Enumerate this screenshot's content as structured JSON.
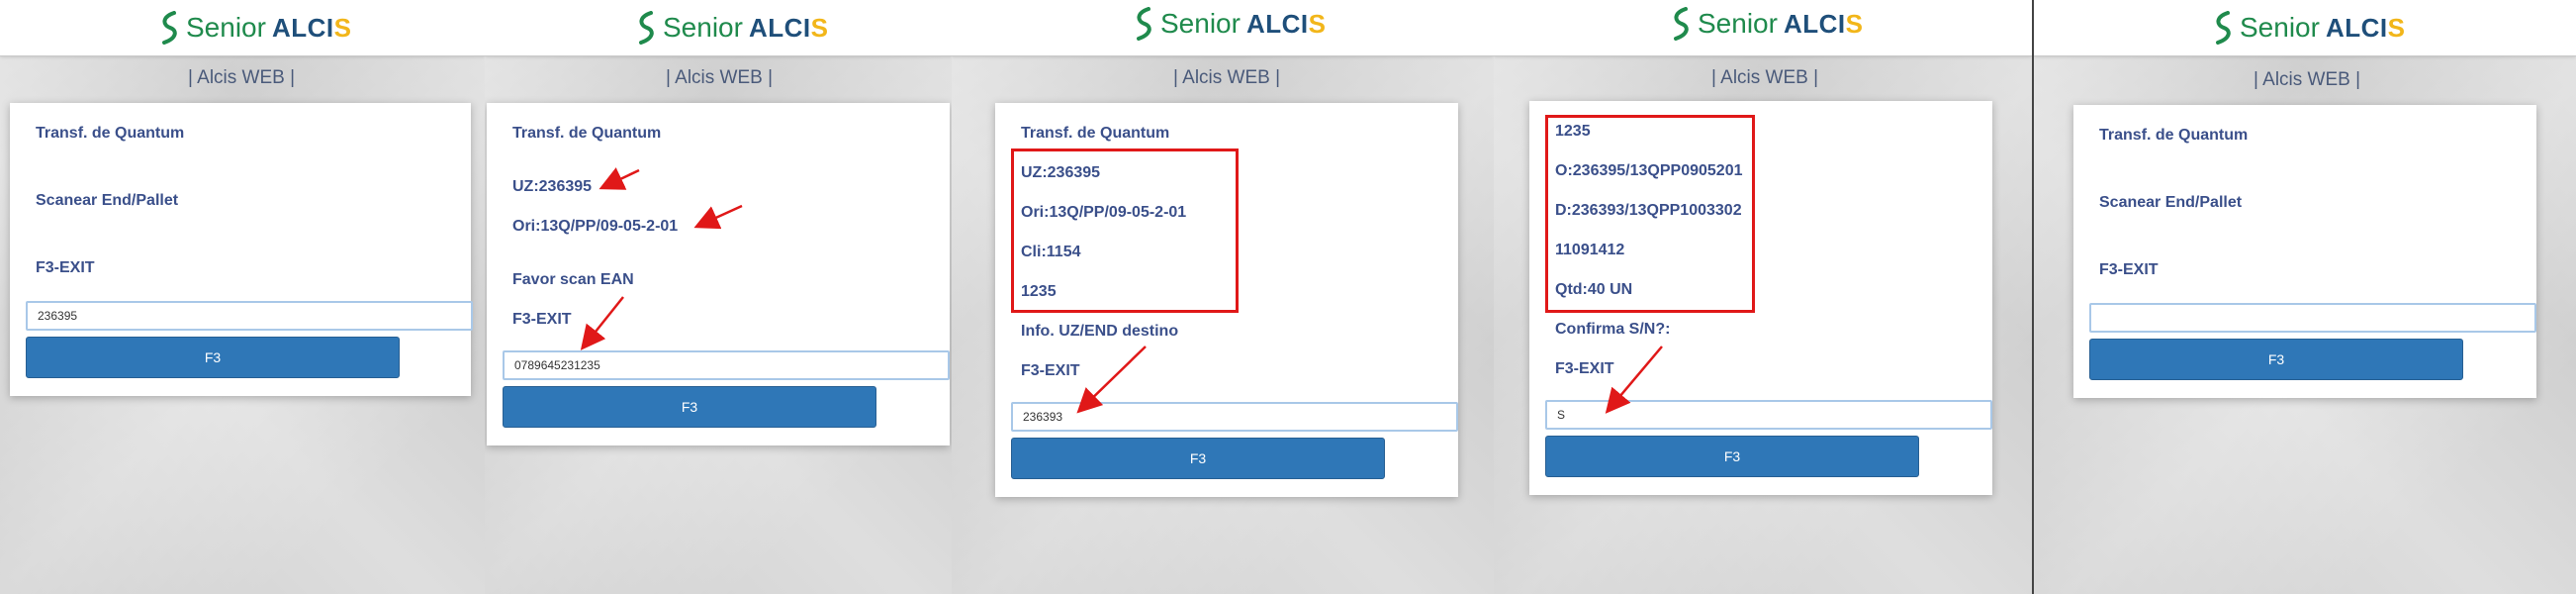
{
  "logo": {
    "senior": "Senior",
    "alcis_main": "ALCI",
    "alcis_s": "S"
  },
  "subtitle": "| Alcis WEB |",
  "colors": {
    "accent_blue": "#2f77b7",
    "text_blue": "#3a4f8a",
    "highlight_red": "#e01818",
    "brand_green": "#1f8a4c",
    "brand_yellow": "#f2b61a"
  },
  "panels": [
    {
      "lines": [
        "Transf. de Quantum",
        "Scanear End/Pallet",
        "F3-EXIT"
      ],
      "input_value": "236395",
      "button": "F3"
    },
    {
      "lines": [
        "Transf. de Quantum",
        "UZ:236395",
        "Ori:13Q/PP/09-05-2-01",
        "Favor scan EAN",
        "F3-EXIT"
      ],
      "input_value": "0789645231235",
      "button": "F3"
    },
    {
      "lines": [
        "Transf. de Quantum",
        "UZ:236395",
        "Ori:13Q/PP/09-05-2-01",
        "Cli:1154",
        "1235",
        "Info. UZ/END destino",
        "F3-EXIT"
      ],
      "input_value": "236393",
      "button": "F3"
    },
    {
      "lines": [
        "1235",
        "O:236395/13QPP0905201",
        "D:236393/13QPP1003302",
        "11091412",
        "Qtd:40 UN",
        "Confirma S/N?:",
        "F3-EXIT"
      ],
      "input_value": "S",
      "button": "F3"
    },
    {
      "lines": [
        "Transf. de Quantum",
        "Scanear End/Pallet",
        "F3-EXIT"
      ],
      "input_value": "",
      "button": "F3"
    }
  ]
}
